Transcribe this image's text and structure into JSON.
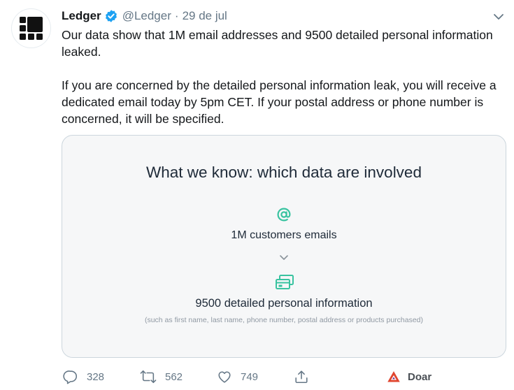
{
  "tweet": {
    "author_name": "Ledger",
    "handle": "@Ledger",
    "separator": "·",
    "date": "29 de jul",
    "paragraphs": [
      "Our data show that 1M email addresses and 9500 detailed personal information leaked.",
      "If you are concerned by the detailed personal information leak, you will receive a dedicated email today by 5pm CET. If your postal address or phone number is concerned, it will be specified."
    ]
  },
  "card": {
    "title": "What we know: which data are involved",
    "emails_label": "1M customers emails",
    "detailed_label": "9500 detailed personal information",
    "note": "(such as first name, last name, phone number, postal address or products purchased)"
  },
  "actions": {
    "replies": "328",
    "retweets": "562",
    "likes": "749",
    "donate_label": "Doar"
  },
  "colors": {
    "accent_teal": "#39c3a0",
    "verified_blue": "#1da1f2",
    "brave_red": "#e0452f",
    "muted": "#657786"
  }
}
